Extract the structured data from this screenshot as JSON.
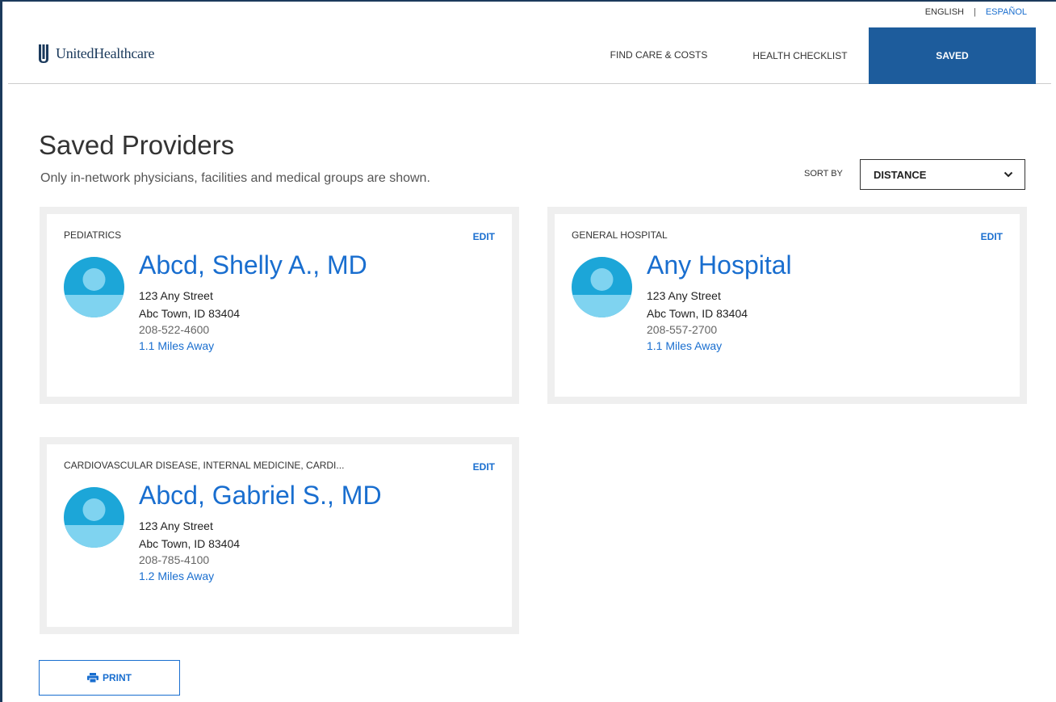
{
  "language": {
    "english": "ENGLISH",
    "separator": "|",
    "espanol": "ESPAÑOL"
  },
  "brand": {
    "name": "UnitedHealthcare",
    "logo_icon": "uhc-shield-logo",
    "color": "#1b3a5c"
  },
  "nav": {
    "find_care": "FIND CARE & COSTS",
    "health_checklist": "HEALTH CHECKLIST",
    "saved": "SAVED"
  },
  "page": {
    "title": "Saved Providers",
    "subtitle": "Only in-network physicians, facilities and medical groups are shown."
  },
  "sort": {
    "label": "SORT BY",
    "value": "DISTANCE"
  },
  "providers": [
    {
      "specialty": "PEDIATRICS",
      "edit": "EDIT",
      "name": "Abcd, Shelly A., MD",
      "address1": "123 Any Street",
      "address2": "Abc Town, ID 83404",
      "phone": "208-522-4600",
      "distance": "1.1 Miles Away"
    },
    {
      "specialty": "GENERAL HOSPITAL",
      "edit": "EDIT",
      "name": "Any Hospital",
      "address1": "123 Any Street",
      "address2": "Abc Town, ID 83404",
      "phone": "208-557-2700",
      "distance": "1.1 Miles Away"
    },
    {
      "specialty": "CARDIOVASCULAR DISEASE, INTERNAL MEDICINE, CARDI...",
      "edit": "EDIT",
      "name": "Abcd, Gabriel S., MD",
      "address1": "123 Any Street",
      "address2": "Abc Town, ID 83404",
      "phone": "208-785-4100",
      "distance": "1.2 Miles Away"
    }
  ],
  "print": {
    "label": "PRINT",
    "icon": "printer-icon"
  },
  "colors": {
    "accent": "#196ecf",
    "nav_active": "#1d5c9c",
    "avatar": "#1ca6d8",
    "avatar_light": "#7fd3f0",
    "card_border": "#efefef"
  }
}
